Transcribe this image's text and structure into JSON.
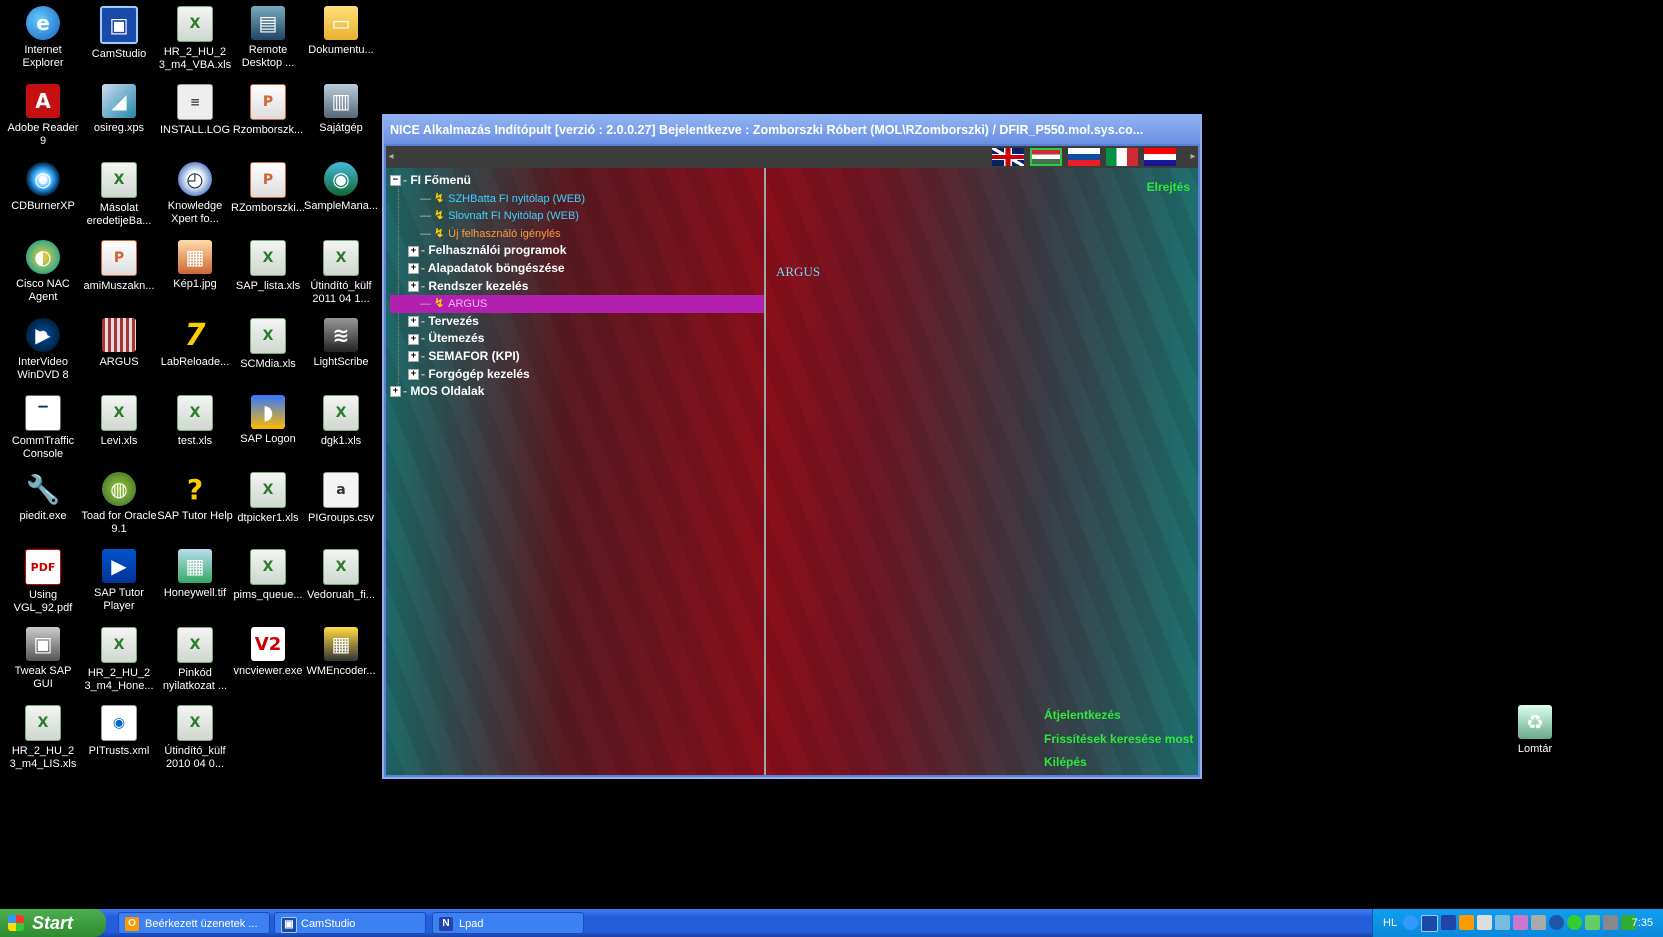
{
  "desktop": {
    "icons": [
      {
        "label": "Internet Explorer",
        "icon": "internet-explorer-icon",
        "glyph": "e"
      },
      {
        "label": "CamStudio",
        "icon": "camstudio-icon",
        "glyph": "▣"
      },
      {
        "label": "HR_2_HU_2 3_m4_VBA.xls",
        "icon": "excel-file-icon",
        "glyph": "X"
      },
      {
        "label": "Remote Desktop ...",
        "icon": "remote-desktop-icon",
        "glyph": "▤"
      },
      {
        "label": "Dokumentu...",
        "icon": "documents-folder-icon",
        "glyph": "▭"
      },
      {
        "label": "Adobe Reader 9",
        "icon": "adobe-reader-icon",
        "glyph": "A"
      },
      {
        "label": "osireg.xps",
        "icon": "xps-file-icon",
        "glyph": "◢"
      },
      {
        "label": "INSTALL.LOG",
        "icon": "log-file-icon",
        "glyph": "≡"
      },
      {
        "label": "Rzomborszk...",
        "icon": "powerpoint-file-icon",
        "glyph": "P"
      },
      {
        "label": "Sajátgép",
        "icon": "my-computer-icon",
        "glyph": "▥"
      },
      {
        "label": "CDBurnerXP",
        "icon": "cdburner-icon",
        "glyph": "◎"
      },
      {
        "label": "Másolat eredetijeBa...",
        "icon": "excel-file-icon",
        "glyph": "X"
      },
      {
        "label": "Knowledge Xpert fo...",
        "icon": "knowledge-xpert-icon",
        "glyph": "◴"
      },
      {
        "label": "RZomborszki...",
        "icon": "powerpoint-file-icon",
        "glyph": "P"
      },
      {
        "label": "SampleMana...",
        "icon": "sample-manager-icon",
        "glyph": "◉"
      },
      {
        "label": "Cisco NAC Agent",
        "icon": "cisco-nac-icon",
        "glyph": "◐"
      },
      {
        "label": "amiMuszakn...",
        "icon": "powerpoint-file-icon",
        "glyph": "P"
      },
      {
        "label": "Kép1.jpg",
        "icon": "image-file-icon",
        "glyph": "▦"
      },
      {
        "label": "SAP_lista.xls",
        "icon": "excel-file-icon",
        "glyph": "X"
      },
      {
        "label": "Útindító_külf 2011 04 1...",
        "icon": "excel-file-icon",
        "glyph": "X"
      },
      {
        "label": "InterVideo WinDVD 8",
        "icon": "windvd-icon",
        "glyph": "▶"
      },
      {
        "label": "ARGUS",
        "icon": "argus-icon",
        "glyph": ""
      },
      {
        "label": "LabReloade...",
        "icon": "labreloader-icon",
        "glyph": "7"
      },
      {
        "label": "SCMdia.xls",
        "icon": "excel-file-icon",
        "glyph": "X"
      },
      {
        "label": "LightScribe",
        "icon": "lightscribe-icon",
        "glyph": "≋"
      },
      {
        "label": "CommTraffic Console",
        "icon": "commtraffic-icon",
        "glyph": "▔"
      },
      {
        "label": "Levi.xls",
        "icon": "excel-file-icon",
        "glyph": "X"
      },
      {
        "label": "test.xls",
        "icon": "excel-file-icon",
        "glyph": "X"
      },
      {
        "label": "SAP Logon",
        "icon": "sap-logon-icon",
        "glyph": "◗"
      },
      {
        "label": "dgk1.xls",
        "icon": "excel-file-icon",
        "glyph": "X"
      },
      {
        "label": "piedit.exe",
        "icon": "wrench-icon",
        "glyph": "🔧"
      },
      {
        "label": "Toad for Oracle 9.1",
        "icon": "toad-icon",
        "glyph": "◍"
      },
      {
        "label": "SAP Tutor Help",
        "icon": "help-icon",
        "glyph": "?"
      },
      {
        "label": "dtpicker1.xls",
        "icon": "excel-file-icon",
        "glyph": "X"
      },
      {
        "label": "PIGroups.csv",
        "icon": "csv-file-icon",
        "glyph": "a"
      },
      {
        "label": "Using VGL_92.pdf",
        "icon": "pdf-file-icon",
        "glyph": "PDF"
      },
      {
        "label": "SAP Tutor Player",
        "icon": "sap-tutor-icon",
        "glyph": "▶"
      },
      {
        "label": "Honeywell.tif",
        "icon": "tif-file-icon",
        "glyph": "▦"
      },
      {
        "label": "pims_queue...",
        "icon": "excel-file-icon",
        "glyph": "X"
      },
      {
        "label": "Vedoruah_fi...",
        "icon": "excel-file-icon",
        "glyph": "X"
      },
      {
        "label": "Tweak SAP GUI",
        "icon": "tweak-sap-gui-icon",
        "glyph": "▣"
      },
      {
        "label": "HR_2_HU_2 3_m4_Hone...",
        "icon": "excel-file-icon",
        "glyph": "X"
      },
      {
        "label": "Pinkód nyilatkozat ...",
        "icon": "excel-file-icon",
        "glyph": "X"
      },
      {
        "label": "vncviewer.exe",
        "icon": "vnc-viewer-icon",
        "glyph": "V2"
      },
      {
        "label": "WMEncoder...",
        "icon": "wmencoder-icon",
        "glyph": "▦"
      },
      {
        "label": "HR_2_HU_2 3_m4_LIS.xls",
        "icon": "excel-file-icon",
        "glyph": "X"
      },
      {
        "label": "PITrusts.xml",
        "icon": "xml-file-icon",
        "glyph": "◉"
      },
      {
        "label": "Útindító_külf 2010 04 0...",
        "icon": "excel-file-icon",
        "glyph": "X"
      },
      {
        "label": "Lomtár",
        "icon": "recycle-bin-icon",
        "glyph": "♻"
      }
    ]
  },
  "app": {
    "title": "NICE Alkalmazás Indítópult  [verzió : 2.0.0.27]   Bejelentkezve : Zomborszki Róbert  (MOL\\RZomborszki) / DFIR_P550.mol.sys.co...",
    "flags": [
      "english-flag-icon",
      "hungarian-flag-icon",
      "slovak-flag-icon",
      "italian-flag-icon",
      "croatian-flag-icon"
    ],
    "hide_label": "Elrejtés",
    "tree": {
      "root_label": "FI Főmenü",
      "leaf_1": "SZHBatta FI nyitólap (WEB)",
      "leaf_2": "Slovnaft FI Nyitólap (WEB)",
      "leaf_3": "Új felhasználó igénylés",
      "group_1": "Felhasználói programok",
      "group_2": "Alapadatok böngészése",
      "group_3": "Rendszer kezelés",
      "selected_leaf": "ARGUS",
      "group_4": "Tervezés",
      "group_5": "Ütemezés",
      "group_6": "SEMAFOR (KPI)",
      "group_7": "Forgógép kezelés",
      "root_2": "MOS Oldalak"
    },
    "detail_title": "ARGUS",
    "actions": {
      "relogin": "Átjelentkezés",
      "check_updates": "Frissítések keresése most",
      "exit": "Kilépés"
    }
  },
  "taskbar": {
    "start_label": "Start",
    "buttons": [
      {
        "label": "Beérkezett üzenetek ...",
        "icon": "outlook-icon",
        "glyph": "O"
      },
      {
        "label": "CamStudio",
        "icon": "camstudio-icon",
        "glyph": "▣"
      },
      {
        "label": "Lpad",
        "icon": "lpad-icon",
        "glyph": "N"
      }
    ],
    "language": "HL",
    "clock": "7:35"
  }
}
